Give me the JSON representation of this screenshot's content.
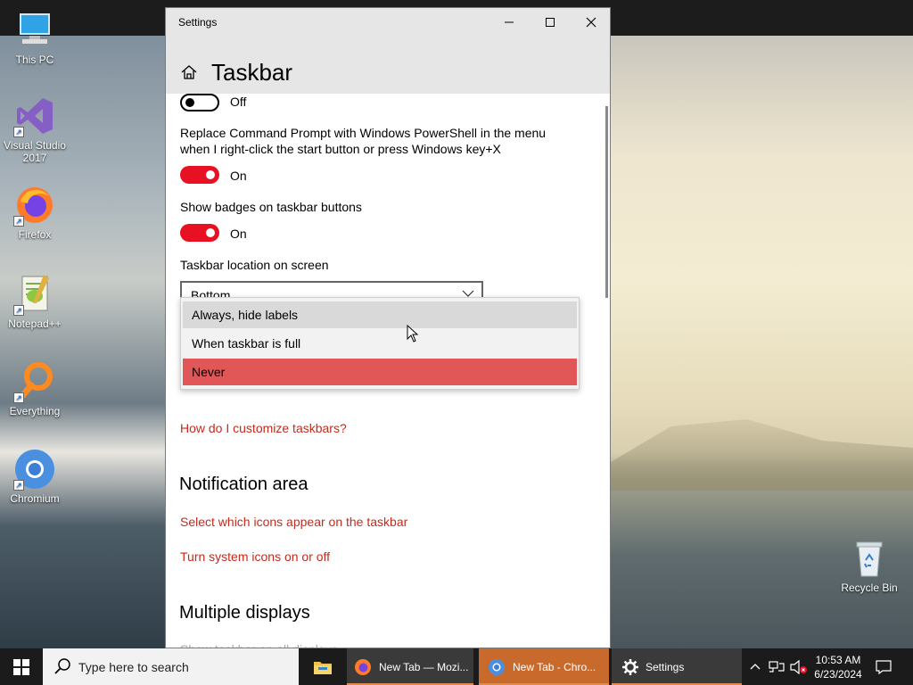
{
  "desktop": {
    "icons": [
      {
        "label": "This PC"
      },
      {
        "label": "Visual Studio 2017"
      },
      {
        "label": "Firefox"
      },
      {
        "label": "Notepad++"
      },
      {
        "label": "Everything"
      },
      {
        "label": "Chromium"
      },
      {
        "label": "Recycle Bin"
      }
    ]
  },
  "window": {
    "title": "Settings",
    "page_title": "Taskbar",
    "controls": {
      "minimize": "minimize-icon",
      "maximize": "maximize-icon",
      "close": "close-icon"
    }
  },
  "settings": {
    "top_toggle_state": "Off",
    "powershell_label": "Replace Command Prompt with Windows PowerShell in the menu when I right-click the start button or press Windows key+X",
    "powershell_state": "On",
    "badges_label": "Show badges on taskbar buttons",
    "badges_state": "On",
    "location_label": "Taskbar location on screen",
    "location_value": "Bottom",
    "combine_dropdown": {
      "options": [
        "Always, hide labels",
        "When taskbar is full",
        "Never"
      ],
      "hovered": "Always, hide labels",
      "selected": "Never"
    },
    "customize_link": "How do I customize taskbars?",
    "notification_heading": "Notification area",
    "notification_links": [
      "Select which icons appear on the taskbar",
      "Turn system icons on or off"
    ],
    "multiple_heading": "Multiple displays",
    "multiple_first": "Show taskbar on all displays"
  },
  "taskbar": {
    "search_placeholder": "Type here to search",
    "apps": [
      {
        "label": ""
      },
      {
        "label": "New Tab — Mozi..."
      },
      {
        "label": "New Tab - Chro..."
      },
      {
        "label": "Settings"
      }
    ],
    "clock_time": "10:53 AM",
    "clock_date": "6/23/2024"
  },
  "colors": {
    "accent": "#e81123",
    "selected_option": "#e15656",
    "link": "#c42b1c",
    "active_taskbar_app": "#c86a2c"
  }
}
